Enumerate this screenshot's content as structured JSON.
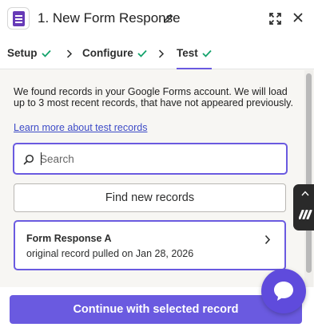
{
  "header": {
    "title": "1. New Form Response",
    "app_icon": "google-forms-icon",
    "edit_icon": "pencil-icon",
    "expand_icon": "expand-icon",
    "close_icon": "close-icon"
  },
  "steps": [
    {
      "label": "Setup",
      "status": "complete"
    },
    {
      "label": "Configure",
      "status": "complete"
    },
    {
      "label": "Test",
      "status": "complete",
      "active": true
    }
  ],
  "content": {
    "intro_text": "We found records in your Google Forms account. We will load up to 3 most recent records, that have not appeared previously.",
    "learn_link": "Learn more about test records",
    "search": {
      "placeholder": "Search",
      "value": ""
    },
    "find_button": "Find new records",
    "records": [
      {
        "title": "Form Response A",
        "subtitle": "original record pulled on Jan 28, 2026",
        "selected": true
      }
    ]
  },
  "footer": {
    "continue_button": "Continue with selected record"
  },
  "colors": {
    "accent": "#6a5ae0",
    "check": "#13a36b",
    "link": "#3d4bc7",
    "panel_bg": "#f7f6f3",
    "forms_purple": "#673ab7"
  }
}
